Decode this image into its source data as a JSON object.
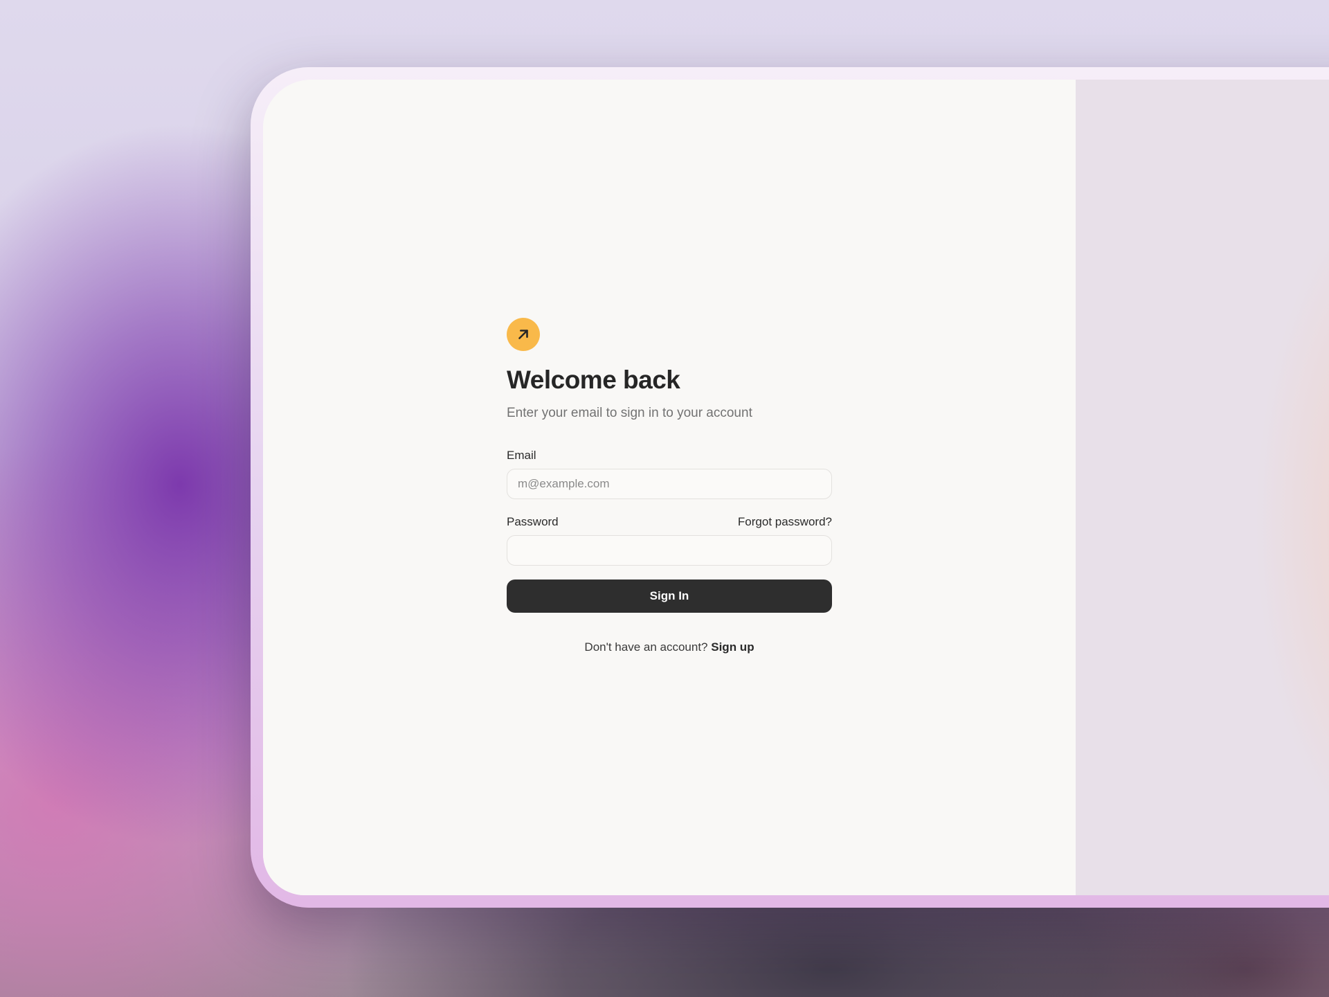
{
  "login": {
    "logo_icon": "arrow-up-right-icon",
    "title": "Welcome back",
    "subtitle": "Enter your email to sign in to your account",
    "email_label": "Email",
    "email_placeholder": "m@example.com",
    "email_value": "",
    "password_label": "Password",
    "password_value": "",
    "forgot_password": "Forgot password?",
    "submit_label": "Sign In",
    "no_account_text": "Don't have an account?",
    "signup_link": "Sign up"
  },
  "colors": {
    "accent": "#f9b94a",
    "primary_button": "#2e2e2e",
    "panel_background": "#f9f8f6"
  }
}
